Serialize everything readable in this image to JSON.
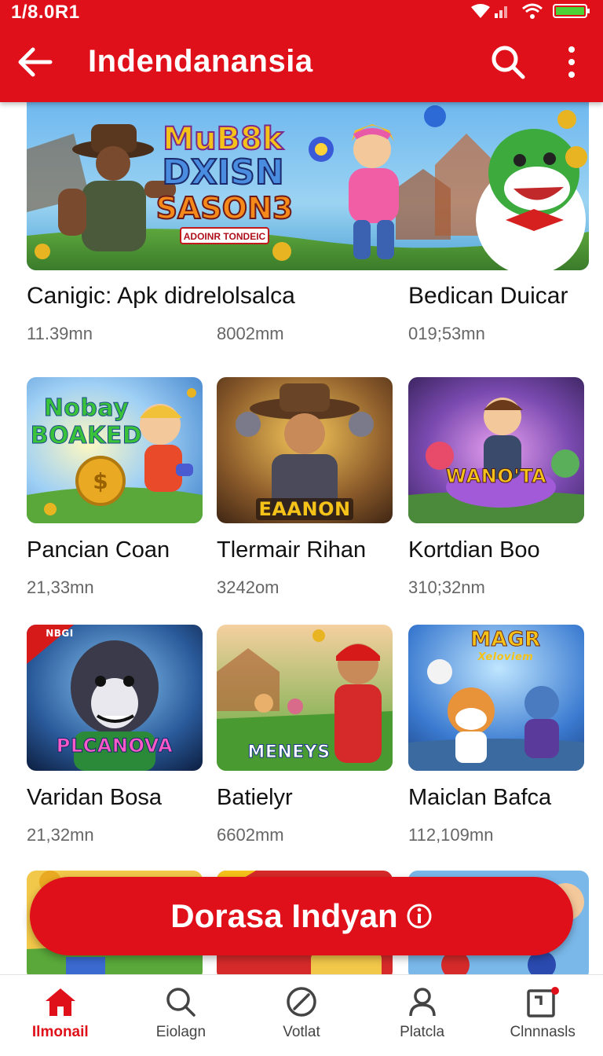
{
  "status_bar": {
    "time": "1/8.0R1"
  },
  "app_bar": {
    "title": "Indendanansia"
  },
  "banner": {
    "line1": "MuB8k",
    "line2": "DXISN",
    "line3": "SASON3",
    "tagline": "ADOINR TONDEIC"
  },
  "featured": [
    {
      "title": "Canigic: Apk didrelolsalca",
      "meta": "11.39mn"
    },
    {
      "title": "",
      "meta": "8002mm"
    },
    {
      "title": "Bedican Duicar",
      "meta": "019;53mn"
    }
  ],
  "games": [
    {
      "name": "Pancian Coan",
      "meta": "21,33mn",
      "thumb_label": "Nobay BOAKED"
    },
    {
      "name": "Tlermair Rihan",
      "meta": "3242om",
      "thumb_label": "EAANON"
    },
    {
      "name": "Kortdian Boo",
      "meta": "310;32nm",
      "thumb_label": "WANO'TA"
    },
    {
      "name": "Varidan Bosa",
      "meta": "21,32mn",
      "thumb_label": "PLCANOVA",
      "thumb_corner": "NBGI"
    },
    {
      "name": "Batielyr",
      "meta": "6602mm",
      "thumb_label": "MENEYS"
    },
    {
      "name": "Maiclan Bafca",
      "meta": "112,109mn",
      "thumb_label": "MAGR",
      "thumb_sub": "Xeloviem"
    }
  ],
  "cta": {
    "label": "Dorasa Indyan"
  },
  "bottom_nav": [
    {
      "label": "Ilmonail",
      "icon": "home-icon",
      "active": true
    },
    {
      "label": "Eiolagn",
      "icon": "search-icon",
      "active": false
    },
    {
      "label": "Votlat",
      "icon": "compass-icon",
      "active": false
    },
    {
      "label": "Platcla",
      "icon": "profile-icon",
      "active": false
    },
    {
      "label": "Clnnnasls",
      "icon": "notifications-icon",
      "active": false
    }
  ],
  "colors": {
    "accent": "#e0101a",
    "meta_text": "#666666",
    "title_text": "#111111"
  }
}
